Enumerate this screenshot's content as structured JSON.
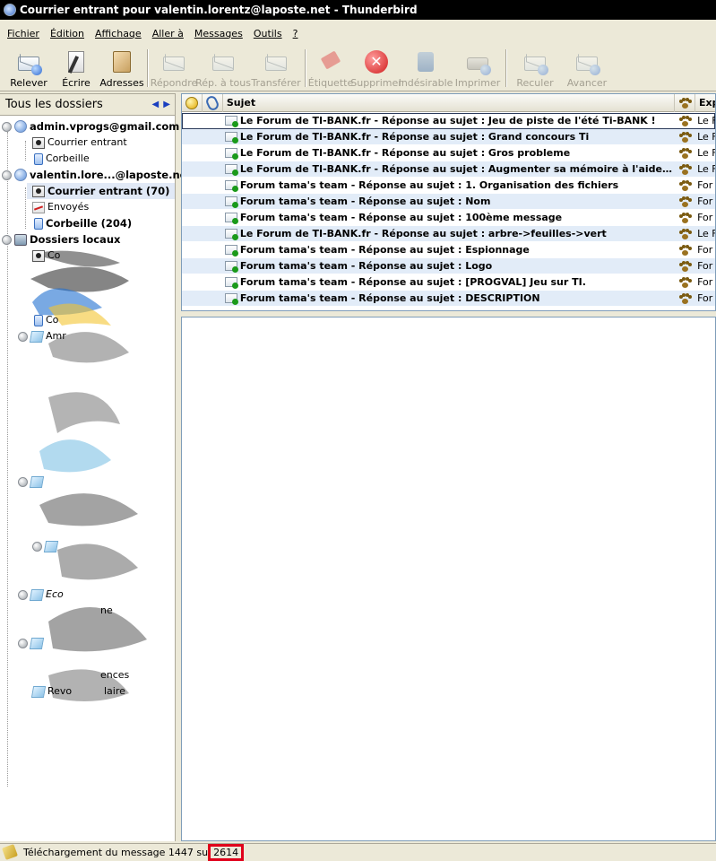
{
  "window": {
    "title": "Courrier entrant pour valentin.lorentz@laposte.net - Thunderbird"
  },
  "menu": [
    "Fichier",
    "Édition",
    "Affichage",
    "Aller à",
    "Messages",
    "Outils",
    "?"
  ],
  "toolbar": {
    "get_mail": "Relever",
    "write": "Écrire",
    "address_book": "Adresses",
    "reply": "Répondre",
    "reply_all": "Rép. à tous",
    "forward": "Transférer",
    "tag": "Étiquette",
    "delete": "Supprimer",
    "junk": "Indésirable",
    "print": "Imprimer",
    "back": "Reculer",
    "forward_nav": "Avancer"
  },
  "folder_pane": {
    "header": "Tous les dossiers",
    "accounts": [
      {
        "name": "admin.vprogs@gmail.com",
        "folders": [
          "Courrier entrant",
          "Corbeille"
        ]
      },
      {
        "name": "valentin.lore...@laposte.net",
        "folders": [
          "Courrier entrant (70)",
          "Envoyés",
          "Corbeille (204)"
        ]
      },
      {
        "name": "Dossiers locaux",
        "folders": []
      }
    ],
    "partial_labels": [
      "Co",
      "Amr",
      "Eco",
      "ne",
      "ences",
      "Revo",
      "laire"
    ]
  },
  "thread_pane": {
    "columns": {
      "subject": "Sujet",
      "sender": "Exp"
    },
    "rows": [
      {
        "subject": "Le Forum de TI-BANK.fr - Réponse au sujet : Jeu de piste de l'été Ti-BANK !",
        "sender": "Le F"
      },
      {
        "subject": "Le Forum de TI-BANK.fr - Réponse au sujet : Grand concours Ti",
        "sender": "Le F"
      },
      {
        "subject": "Le Forum de TI-BANK.fr - Réponse au sujet : Gros probleme",
        "sender": "Le F"
      },
      {
        "subject": "Le Forum de TI-BANK.fr - Réponse au sujet : Augmenter sa mémoire à l'aide d'une cl...",
        "sender": "Le F"
      },
      {
        "subject": "Forum tama's team - Réponse au sujet : 1. Organisation des fichiers",
        "sender": "For"
      },
      {
        "subject": "Forum tama's team - Réponse au sujet : Nom",
        "sender": "For"
      },
      {
        "subject": "Forum tama's team - Réponse au sujet : 100ème message",
        "sender": "For"
      },
      {
        "subject": "Le Forum de TI-BANK.fr - Réponse au sujet : arbre->feuilles->vert",
        "sender": "Le F"
      },
      {
        "subject": "Forum tama's team - Réponse au sujet : Espionnage",
        "sender": "For"
      },
      {
        "subject": "Forum tama's team - Réponse au sujet : Logo",
        "sender": "For"
      },
      {
        "subject": "Forum tama's team - Réponse au sujet : [PROGVAL] Jeu sur TI.",
        "sender": "For"
      },
      {
        "subject": "Forum tama's team - Réponse au sujet : DESCRIPTION",
        "sender": "For"
      }
    ]
  },
  "status": {
    "text": "Téléchargement du message 1447 su",
    "total": "2614"
  }
}
